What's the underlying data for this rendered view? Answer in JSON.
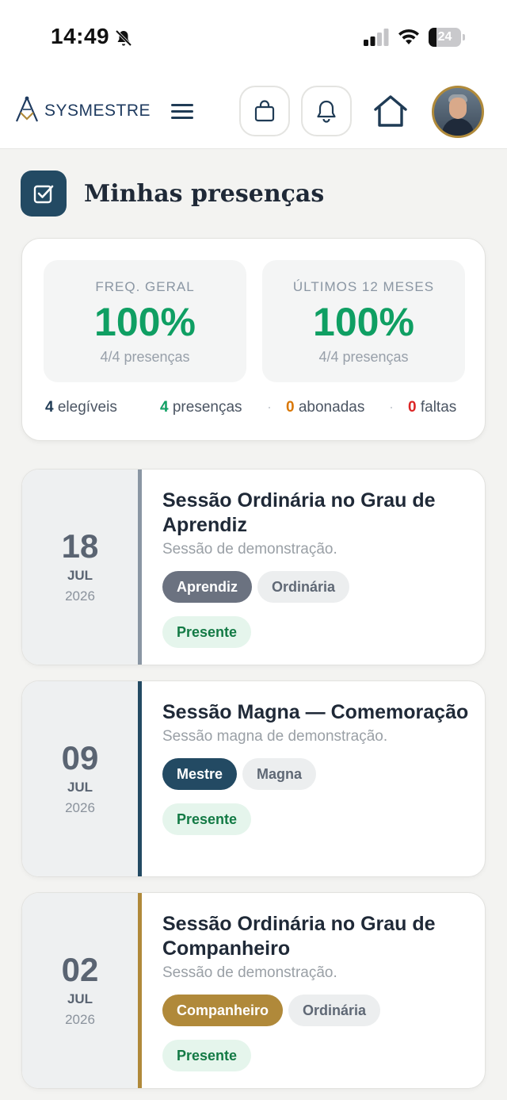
{
  "status_bar": {
    "time": "14:49",
    "battery": "24",
    "battery_level": 0.24
  },
  "header": {
    "logo_text": "SYSMESTRE"
  },
  "page": {
    "title": "Minhas presenças"
  },
  "summary": {
    "freq_label": "FREQ. GERAL",
    "freq_value": "100%",
    "freq_sub": "4/4 presenças",
    "last12_label": "ÚLTIMOS 12 MESES",
    "last12_value": "100%",
    "last12_sub": "4/4 presenças",
    "elegiveis_num": "4",
    "elegiveis_label": " elegíveis",
    "presencas_num": "4",
    "presencas_label": " presenças",
    "abonadas_num": "0",
    "abonadas_label": " abonadas",
    "faltas_num": "0",
    "faltas_label": " faltas"
  },
  "colors": {
    "aprendiz": "#6b7280",
    "mestre": "#234a63",
    "companheiro": "#b0893a",
    "green": "#0f9f63",
    "orange": "#d97706",
    "red": "#dc2626"
  },
  "sessions": [
    {
      "day": "18",
      "month": "JUL",
      "year": "2026",
      "title": "Sessão Ordinária no Grau de Aprendiz",
      "desc": "Sessão de demonstração.",
      "grau": "Aprendiz",
      "tipo": "Ordinária",
      "status": "Presente"
    },
    {
      "day": "09",
      "month": "JUL",
      "year": "2026",
      "title": "Sessão Magna — Comemoração",
      "desc": "Sessão magna de demonstração.",
      "grau": "Mestre",
      "tipo": "Magna",
      "status": "Presente"
    },
    {
      "day": "02",
      "month": "JUL",
      "year": "2026",
      "title": "Sessão Ordinária no Grau de Companheiro",
      "desc": "Sessão de demonstração.",
      "grau": "Companheiro",
      "tipo": "Ordinária",
      "status": "Presente"
    }
  ]
}
